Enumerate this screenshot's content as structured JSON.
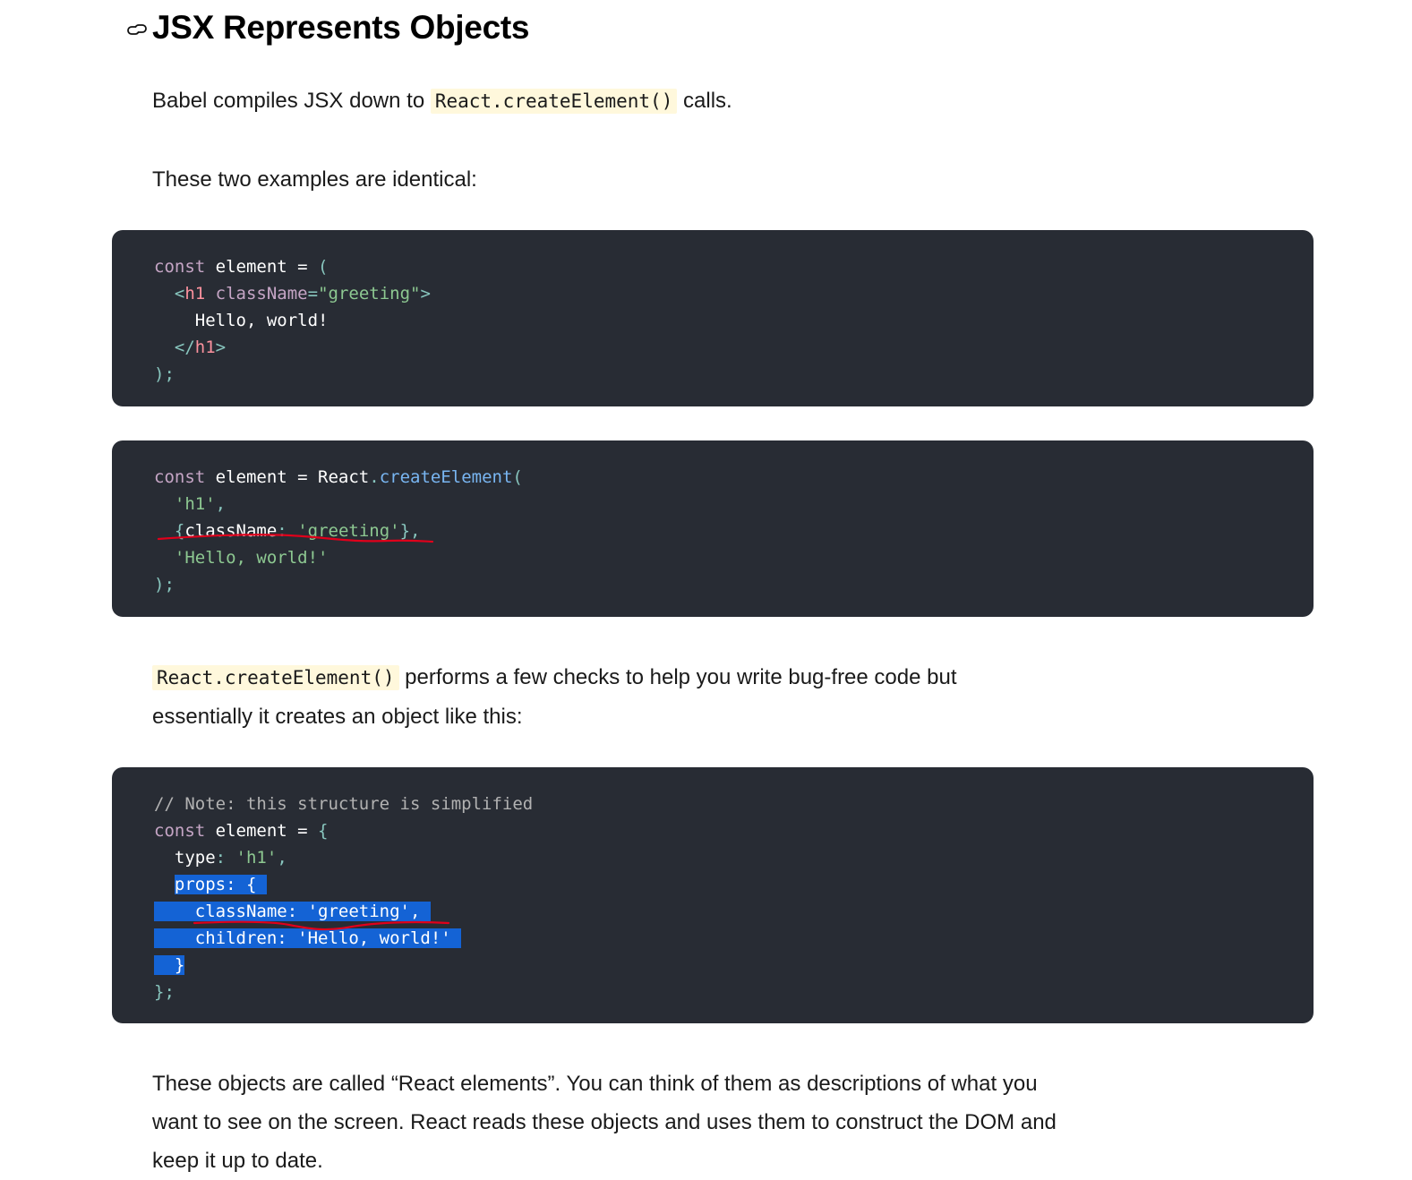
{
  "heading": {
    "title": "JSX Represents Objects",
    "link_icon": "link-icon"
  },
  "intro": {
    "prefix": "Babel compiles JSX down to ",
    "code": "React.createElement()",
    "suffix": " calls."
  },
  "identical_text": "These two examples are identical:",
  "code_block_1": {
    "lines": [
      [
        {
          "t": "const",
          "c": "kw"
        },
        {
          "t": " element ",
          "c": "plain"
        },
        {
          "t": "=",
          "c": "plain"
        },
        {
          "t": " (",
          "c": "punct"
        }
      ],
      [
        {
          "t": "  <",
          "c": "punct"
        },
        {
          "t": "h1",
          "c": "tag"
        },
        {
          "t": " className",
          "c": "attr"
        },
        {
          "t": "=",
          "c": "punct"
        },
        {
          "t": "\"greeting\"",
          "c": "str"
        },
        {
          "t": ">",
          "c": "punct"
        }
      ],
      [
        {
          "t": "    Hello, world!",
          "c": "plain"
        }
      ],
      [
        {
          "t": "  </",
          "c": "punct"
        },
        {
          "t": "h1",
          "c": "tag"
        },
        {
          "t": ">",
          "c": "punct"
        }
      ],
      [
        {
          "t": ");",
          "c": "punct"
        }
      ]
    ]
  },
  "code_block_2": {
    "lines": [
      [
        {
          "t": "const",
          "c": "kw"
        },
        {
          "t": " element ",
          "c": "plain"
        },
        {
          "t": "=",
          "c": "plain"
        },
        {
          "t": " React",
          "c": "plain"
        },
        {
          "t": ".",
          "c": "punct"
        },
        {
          "t": "createElement",
          "c": "fn"
        },
        {
          "t": "(",
          "c": "punct"
        }
      ],
      [
        {
          "t": "  ",
          "c": "plain"
        },
        {
          "t": "'h1'",
          "c": "str"
        },
        {
          "t": ",",
          "c": "punct"
        }
      ],
      [
        {
          "t": "  ",
          "c": "plain"
        },
        {
          "t": "{",
          "c": "punct"
        },
        {
          "t": "className",
          "c": "plain"
        },
        {
          "t": ":",
          "c": "punct"
        },
        {
          "t": " ",
          "c": "plain"
        },
        {
          "t": "'greeting'",
          "c": "str"
        },
        {
          "t": "},",
          "c": "punct"
        }
      ],
      [
        {
          "t": "  ",
          "c": "plain"
        },
        {
          "t": "'Hello, world!'",
          "c": "str"
        }
      ],
      [
        {
          "t": ");",
          "c": "punct"
        }
      ]
    ]
  },
  "checks": {
    "code": "React.createElement()",
    "line1_suffix": " performs a few checks to help you write bug-free code but",
    "line2": "essentially it creates an object like this:"
  },
  "code_block_3": {
    "lines": [
      [
        {
          "t": "// Note: this structure is simplified",
          "c": "comment"
        }
      ],
      [
        {
          "t": "const",
          "c": "kw"
        },
        {
          "t": " element ",
          "c": "plain"
        },
        {
          "t": "=",
          "c": "plain"
        },
        {
          "t": " {",
          "c": "punct"
        }
      ],
      [
        {
          "t": "  type",
          "c": "plain"
        },
        {
          "t": ":",
          "c": "punct"
        },
        {
          "t": " ",
          "c": "plain"
        },
        {
          "t": "'h1'",
          "c": "str"
        },
        {
          "t": ",",
          "c": "punct"
        }
      ],
      [
        {
          "t": "  ",
          "c": "plain"
        },
        {
          "t": "props: { ",
          "c": "plain",
          "sel": true
        }
      ],
      [
        {
          "t": "  ",
          "c": "plain",
          "sel": true
        },
        {
          "t": "  className: 'greeting', ",
          "c": "plain",
          "sel": true
        }
      ],
      [
        {
          "t": "  ",
          "c": "plain",
          "sel": true
        },
        {
          "t": "  children: 'Hello, world!' ",
          "c": "plain",
          "sel": true
        }
      ],
      [
        {
          "t": "  }",
          "c": "plain",
          "sel": true
        }
      ],
      [
        {
          "t": "};",
          "c": "punct"
        }
      ]
    ]
  },
  "elements_para": {
    "line1": "These objects are called “React elements”. You can think of them as descriptions of what you",
    "line2": "want to see on the screen. React reads these objects and uses them to construct the DOM and",
    "line3": "keep it up to date."
  },
  "colors": {
    "code_bg": "#282c34",
    "inline_code_bg": "#fff8dc",
    "selection": "#1463d5",
    "annotation_red": "#e0001b"
  }
}
